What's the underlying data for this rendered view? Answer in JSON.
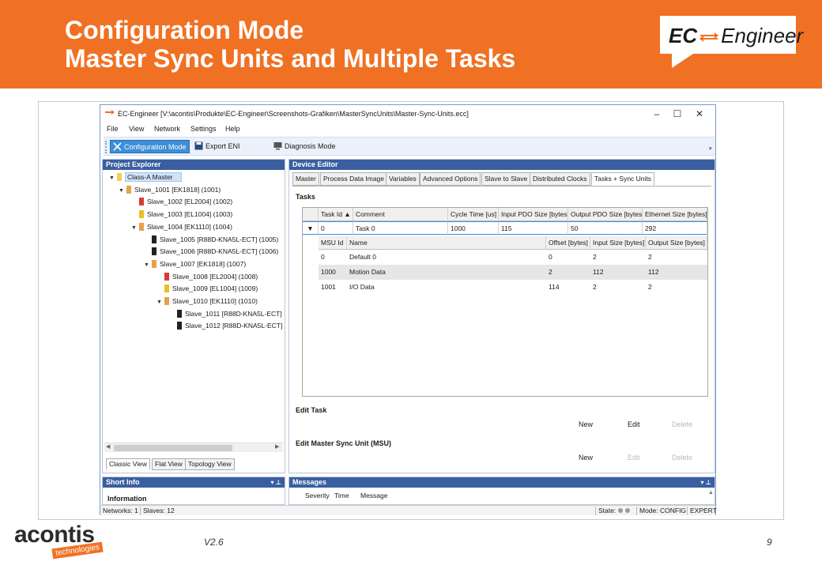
{
  "slide": {
    "title_line1": "Configuration Mode",
    "title_line2": "Master Sync Units and Multiple Tasks",
    "logo_ec": "EC",
    "logo_engineer": "Engineer",
    "version": "V2.6",
    "page_number": "9",
    "footer_brand": "acontis",
    "footer_sub": "technologies",
    "accent_color": "#f07124"
  },
  "window": {
    "title": "EC-Engineer [V:\\acontis\\Produkte\\EC-Engineer\\Screenshots-Grafiken\\MasterSyncUnits\\Master-Sync-Units.ecc]",
    "min_icon": "minimize-icon",
    "max_icon": "maximize-icon",
    "close_icon": "close-icon"
  },
  "menu": [
    "File",
    "View",
    "Network",
    "Settings",
    "Help"
  ],
  "toolbar": {
    "config_mode": "Configuration Mode",
    "export_eni": "Export ENI",
    "diagnosis_mode": "Diagnosis Mode"
  },
  "explorer": {
    "title": "Project Explorer",
    "tree": [
      {
        "label": "Class-A Master",
        "level": 0,
        "expander": "▼",
        "color": "#f2d04a"
      },
      {
        "label": "Slave_1001 [EK1818] (1001)",
        "level": 1,
        "expander": "▼",
        "color": "#e9a04a"
      },
      {
        "label": "Slave_1002 [EL2004] (1002)",
        "level": 2,
        "expander": "",
        "color": "#d93b3b"
      },
      {
        "label": "Slave_1003 [EL1004] (1003)",
        "level": 2,
        "expander": "",
        "color": "#e6c21a"
      },
      {
        "label": "Slave_1004 [EK1110] (1004)",
        "level": 2,
        "expander": "▼",
        "color": "#e9a04a"
      },
      {
        "label": "Slave_1005 [R88D-KNA5L-ECT] (1005)",
        "level": 3,
        "expander": "",
        "color": "#222222"
      },
      {
        "label": "Slave_1006 [R88D-KNA5L-ECT] (1006)",
        "level": 3,
        "expander": "",
        "color": "#222222"
      },
      {
        "label": "Slave_1007 [EK1818] (1007)",
        "level": 3,
        "expander": "▼",
        "color": "#e9a04a"
      },
      {
        "label": "Slave_1008 [EL2004] (1008)",
        "level": 4,
        "expander": "",
        "color": "#d93b3b"
      },
      {
        "label": "Slave_1009 [EL1004] (1009)",
        "level": 4,
        "expander": "",
        "color": "#e6c21a"
      },
      {
        "label": "Slave_1010 [EK1110] (1010)",
        "level": 4,
        "expander": "▼",
        "color": "#e9a04a"
      },
      {
        "label": "Slave_1011 [R88D-KNA5L-ECT]",
        "level": 5,
        "expander": "",
        "color": "#222222"
      },
      {
        "label": "Slave_1012 [R88D-KNA5L-ECT]",
        "level": 5,
        "expander": "",
        "color": "#222222"
      }
    ],
    "tabs": [
      "Classic View",
      "Flat View",
      "Topology View"
    ]
  },
  "editor": {
    "title": "Device Editor",
    "tabs": [
      "Master",
      "Process Data Image",
      "Variables",
      "Advanced Options",
      "Slave to Slave",
      "Distributed Clocks",
      "Tasks + Sync Units"
    ],
    "tasks_label": "Tasks",
    "task_columns": [
      "Task Id",
      "Comment",
      "Cycle Time [us]",
      "Input PDO Size [bytes]",
      "Output PDO Size [bytes]",
      "Ethernet Size [bytes]"
    ],
    "task_row": [
      "0",
      "Task 0",
      "1000",
      "115",
      "50",
      "292"
    ],
    "msu_columns": [
      "MSU Id",
      "Name",
      "Offset [bytes]",
      "Input Size [bytes]",
      "Output Size [bytes]"
    ],
    "msu_rows": [
      [
        "0",
        "Default 0",
        "0",
        "2",
        "2"
      ],
      [
        "1000",
        "Motion Data",
        "2",
        "112",
        "112"
      ],
      [
        "1001",
        "I/O Data",
        "114",
        "2",
        "2"
      ]
    ],
    "edit_task_label": "Edit Task",
    "edit_msu_label": "Edit Master Sync Unit (MSU)",
    "new": "New",
    "edit": "Edit",
    "delete": "Delete"
  },
  "short_info": {
    "title": "Short Info",
    "heading": "Information"
  },
  "messages": {
    "title": "Messages",
    "columns": [
      "Severity",
      "Time",
      "Message"
    ]
  },
  "status": {
    "networks": "Networks: 1",
    "slaves": "Slaves: 12",
    "state": "State:",
    "mode": "Mode: CONFIG",
    "level": "EXPERT"
  }
}
